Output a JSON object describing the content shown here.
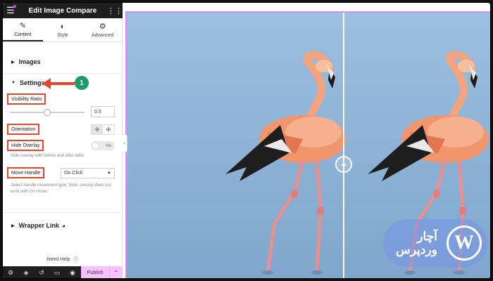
{
  "header": {
    "title": "Edit Image Compare"
  },
  "tabs": [
    {
      "label": "Content",
      "icon": "pencil-icon"
    },
    {
      "label": "Style",
      "icon": "half-circle-icon"
    },
    {
      "label": "Advanced",
      "icon": "gear-icon"
    }
  ],
  "sections": {
    "images": "Images",
    "settings": "Settings",
    "wrapper_link": "Wrapper Link"
  },
  "fields": {
    "visibility_ratio": {
      "label": "Visibility Ratio",
      "value": "0.5",
      "slider_fraction": 0.5
    },
    "orientation": {
      "label": "Orientation"
    },
    "hide_overlay": {
      "label": "Hide Overlay",
      "toggle_text": "No",
      "help": "Hide overlay with before and after label"
    },
    "move_handle": {
      "label": "Move Handle",
      "value": "On Click",
      "help": "Select handle movement type. Note: overlay does not work with On Hover."
    }
  },
  "annotation": {
    "step": "1",
    "color": "#e8432c",
    "badge_color": "#1b9c6a"
  },
  "footer": {
    "need_help": "Need Help",
    "publish": "Publish"
  },
  "watermark": {
    "line1": "آچار",
    "line2": "وردپرس",
    "logo": "W"
  },
  "colors": {
    "accent": "#d98cf0",
    "publish_bg": "#f5c2ff",
    "sky": "#8fb4d6"
  }
}
